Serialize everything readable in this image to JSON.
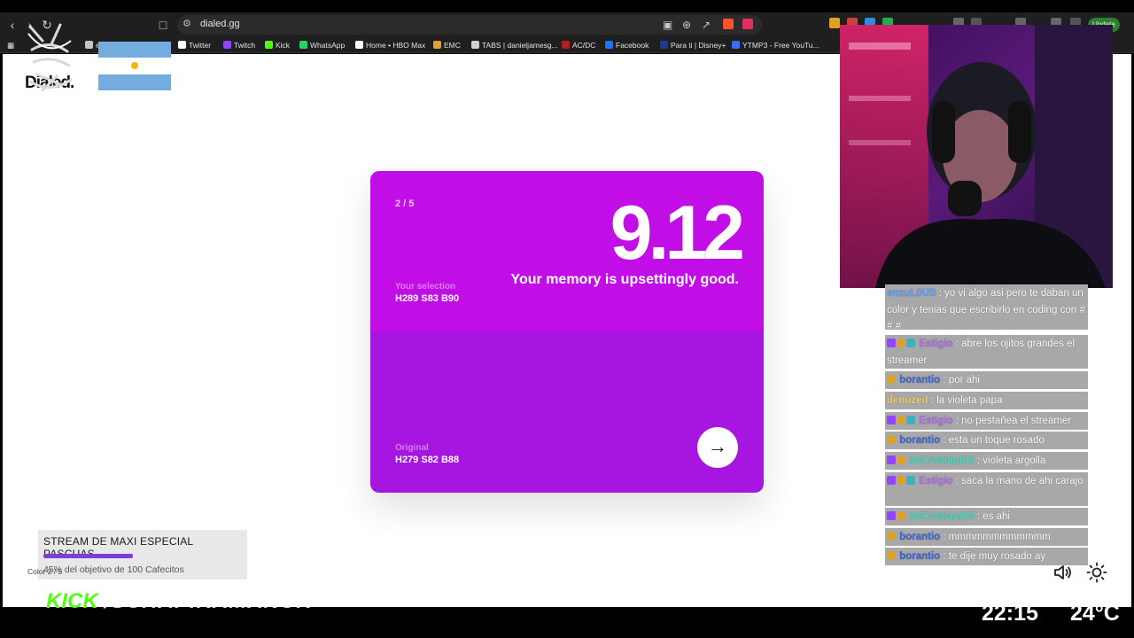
{
  "browser": {
    "url": "dialed.gg",
    "update_label": "Update",
    "bookmarks": [
      {
        "label": "email",
        "color": "#c4c4c4"
      },
      {
        "label": "Twitter",
        "color": "#ffffff"
      },
      {
        "label": "Twitch",
        "color": "#9146ff"
      },
      {
        "label": "Kick",
        "color": "#53fc18"
      },
      {
        "label": "WhatsApp",
        "color": "#25d366"
      },
      {
        "label": "Home • HBO Max",
        "color": "#ffffff"
      },
      {
        "label": "EMC",
        "color": "#e0a030"
      },
      {
        "label": "TABS | danieljamesg...",
        "color": "#d0d0d0"
      },
      {
        "label": "AC/DC",
        "color": "#b02020"
      },
      {
        "label": "Facebook",
        "color": "#1877f2"
      },
      {
        "label": "Para ti | Disney+",
        "color": "#1f3a93"
      },
      {
        "label": "YTMP3 - Free YouTu...",
        "color": "#3b6cff"
      }
    ]
  },
  "game": {
    "logo": "Dialed.",
    "counter": "2 / 5",
    "score": "9.12",
    "verdict": "Your memory is upsettingly good.",
    "selection_label": "Your selection",
    "selection_value": "H289 S83 B90",
    "original_label": "Original",
    "original_value": "H279 S82 B88",
    "selection_color": "#c20ee6",
    "original_color": "#a616e0",
    "next_icon": "arrow-right-icon"
  },
  "chat": {
    "messages": [
      {
        "user": "enzuL0US",
        "user_color": "#5fa0ff",
        "text": ": yo vi algo asi pero te daban un color y tenias que escribirlo en coding con # # #",
        "badges": []
      },
      {
        "user": "Estigio",
        "user_color": "#b06fe8",
        "text": ": abre los ojitos grandes el streamer",
        "badges": [
          "#9146ff",
          "#e0a020",
          "#40b0c0"
        ]
      },
      {
        "user": "borantio",
        "user_color": "#3a66d9",
        "text": ": por ahi",
        "badges": [
          "#e0a020"
        ]
      },
      {
        "user": "denuzed",
        "user_color": "#f0d070",
        "text": ": la violeta papa",
        "badges": []
      },
      {
        "user": "Estigio",
        "user_color": "#b06fe8",
        "text": ": no pestañea el streamer",
        "badges": [
          "#9146ff",
          "#e0a020",
          "#40b0c0"
        ]
      },
      {
        "user": "borantio",
        "user_color": "#3a66d9",
        "text": ": esta un toque rosado",
        "badges": [
          "#e0a020"
        ]
      },
      {
        "user": "ImCristianDG",
        "user_color": "#3fe0c0",
        "text": ": violeta argolla",
        "badges": [
          "#9146ff",
          "#e0a020"
        ]
      },
      {
        "user": "Estigio",
        "user_color": "#b06fe8",
        "text": ": saca la mano de ahi carajo",
        "badges": [
          "#9146ff",
          "#e0a020",
          "#40b0c0"
        ]
      },
      {
        "user": "ImCristianDG",
        "user_color": "#3fe0c0",
        "text": ": es ahi",
        "badges": [
          "#9146ff",
          "#e0a020"
        ]
      },
      {
        "user": "borantio",
        "user_color": "#3a66d9",
        "text": ": mmmmmmmmmmmm",
        "badges": [
          "#e0a020"
        ]
      },
      {
        "user": "borantio",
        "user_color": "#3a66d9",
        "text": ": te dije muy rosado ay",
        "badges": [
          "#e0a020"
        ]
      }
    ]
  },
  "goal": {
    "title": "STREAM DE MAXI ESPECIAL PASCUAS",
    "progress_text": "45% del objetivo de 100 Cafecitos",
    "progress": 0.45,
    "color_info": "Color 2 / 5"
  },
  "stream": {
    "kick_logo": "KICK",
    "channel": "/SCHAPIRAMANUK",
    "clock": "22:15",
    "temperature": "24°C"
  }
}
